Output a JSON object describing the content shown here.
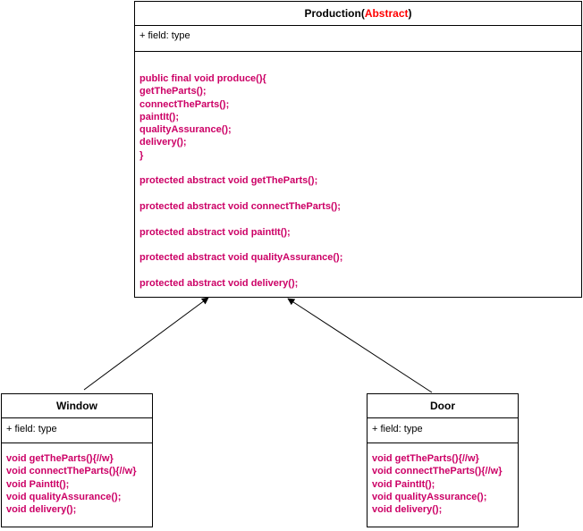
{
  "colors": {
    "method_text": "#CC0066",
    "abstract_keyword": "#FF0000",
    "border": "#000000",
    "background": "#FFFFFF"
  },
  "classes": {
    "production": {
      "name": "Production(",
      "stereotype": "Abstract",
      "name_suffix": ")",
      "field": "+ field: type",
      "methods": [
        "public final void produce(){",
        "getTheParts();",
        "connectTheParts();",
        "paintIt();",
        "qualityAssurance();",
        "delivery();",
        "}",
        "",
        "protected abstract void getTheParts();",
        "",
        "protected abstract void connectTheParts();",
        "",
        "protected abstract void paintIt();",
        "",
        "protected abstract void qualityAssurance();",
        "",
        "protected abstract void delivery();"
      ]
    },
    "window": {
      "name": "Window",
      "field": "+ field: type",
      "methods": [
        "void getTheParts(){//w}",
        "void connectTheParts(){//w}",
        "void PaintIt();",
        "void qualityAssurance();",
        "void delivery();"
      ]
    },
    "door": {
      "name": "Door",
      "field": "+ field: type",
      "methods": [
        "void getTheParts(){//w}",
        "void connectTheParts(){//w}",
        "void PaintIt();",
        "void qualityAssurance();",
        "void delivery();"
      ]
    }
  }
}
